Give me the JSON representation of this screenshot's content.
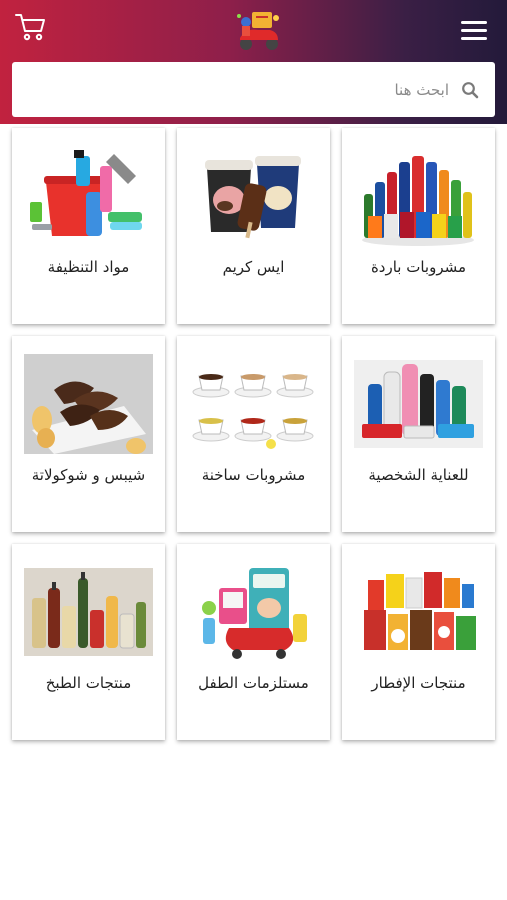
{
  "header": {
    "cart_icon": "cart-icon",
    "logo_icon": "delivery-scooter-logo",
    "menu_icon": "hamburger-menu-icon",
    "colors": {
      "start": "#c1223f",
      "end": "#231a3a"
    }
  },
  "search": {
    "placeholder": "ابحث هنا",
    "value": "",
    "icon": "search-icon"
  },
  "categories": [
    {
      "label": "مشروبات باردة",
      "image": "cold-drinks-image"
    },
    {
      "label": "ايس كريم",
      "image": "ice-cream-image"
    },
    {
      "label": "مواد التنظيفة",
      "image": "cleaning-supplies-image"
    },
    {
      "label": "للعناية الشخصية",
      "image": "personal-care-image"
    },
    {
      "label": "مشروبات ساخنة",
      "image": "hot-drinks-image"
    },
    {
      "label": "شيبس و شوكولاتة",
      "image": "chips-chocolate-image"
    },
    {
      "label": "منتجات الإفطار",
      "image": "breakfast-products-image"
    },
    {
      "label": "مستلزمات الطفل",
      "image": "baby-supplies-image"
    },
    {
      "label": "منتجات الطبخ",
      "image": "cooking-products-image"
    }
  ]
}
